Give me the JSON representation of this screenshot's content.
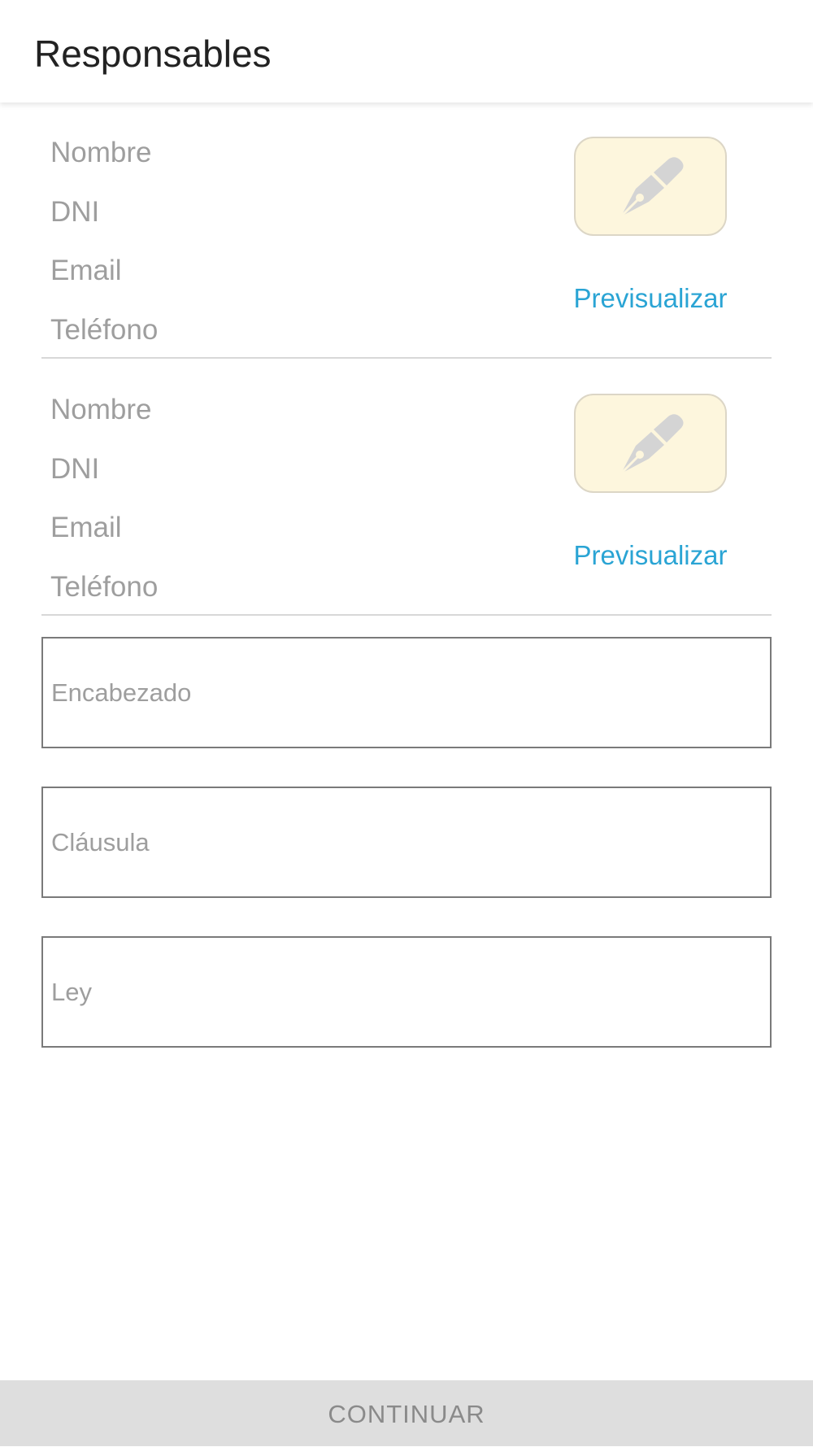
{
  "app_bar": {
    "title": "Responsables"
  },
  "responsables": [
    {
      "fields": [
        "Nombre",
        "DNI",
        "Email",
        "Teléfono"
      ],
      "sign_icon": "fountain-pen-icon",
      "preview_label": "Previsualizar"
    },
    {
      "fields": [
        "Nombre",
        "DNI",
        "Email",
        "Teléfono"
      ],
      "sign_icon": "fountain-pen-icon",
      "preview_label": "Previsualizar"
    }
  ],
  "inputs": {
    "encabezado": {
      "value": "",
      "placeholder": "Encabezado"
    },
    "clausula": {
      "value": "",
      "placeholder": "Cláusula"
    },
    "ley": {
      "value": "",
      "placeholder": "Ley"
    }
  },
  "continue_button": {
    "label": "CONTINUAR"
  },
  "colors": {
    "accent_link": "#2aa4d4",
    "sign_button_bg": "#fdf6dd",
    "disabled_button_bg": "#dedede"
  }
}
